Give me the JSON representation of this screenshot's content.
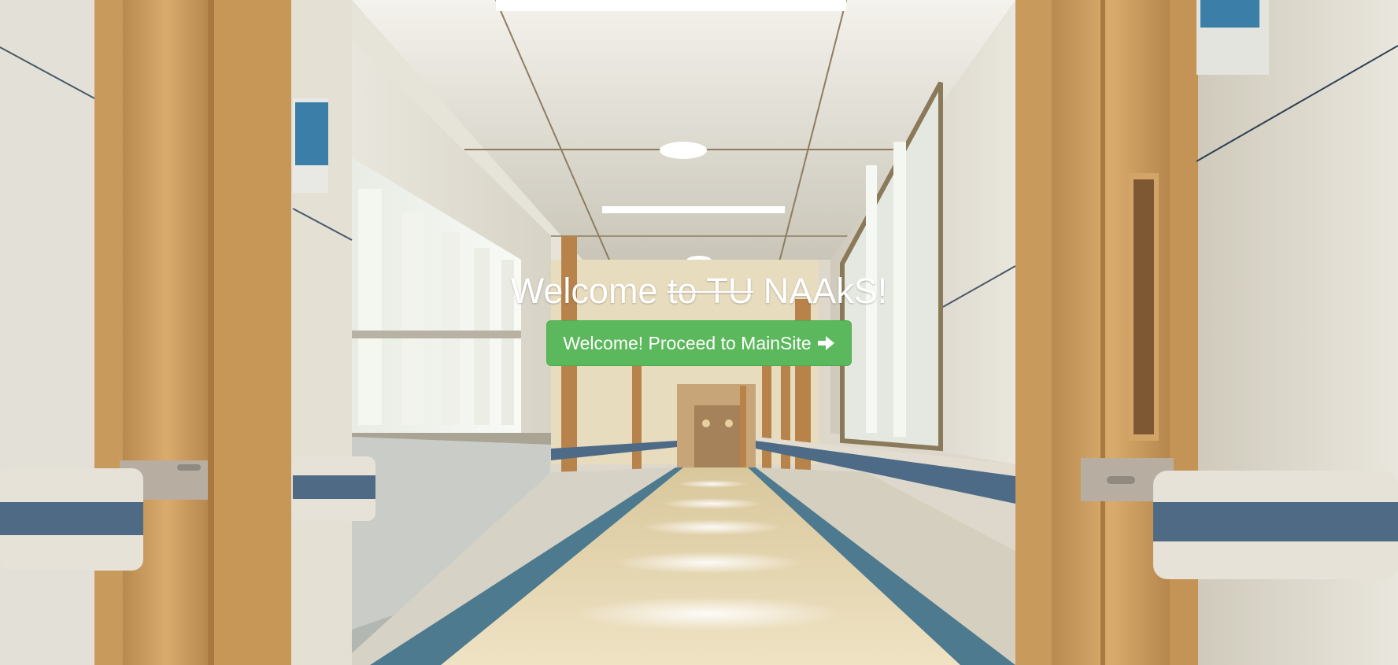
{
  "hero": {
    "title_prefix": "Welcome",
    "title_strike": "to TU",
    "title_suffix": "NAAkS!",
    "button_label": "Welcome! Proceed to MainSite",
    "button_icon": "arrow-right-icon",
    "button_color": "#5cb85c"
  },
  "background": {
    "scene": "hospital-corridor-illustration",
    "floor_color": "#e6d6ae",
    "stripe_color": "#4d6b86",
    "door_color": "#c8975a"
  }
}
